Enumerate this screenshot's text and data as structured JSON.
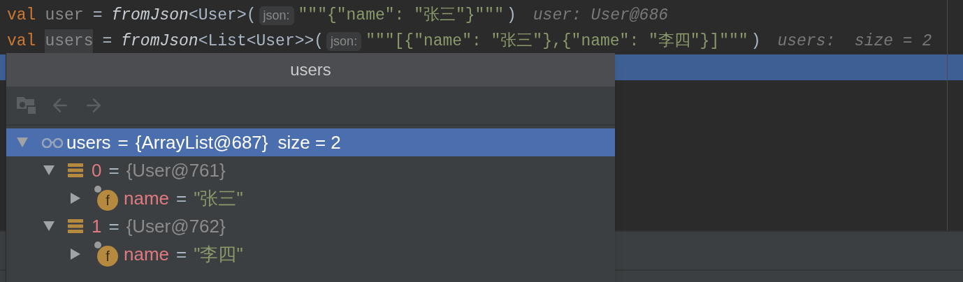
{
  "code_lines": [
    {
      "current": false,
      "tokens": [
        {
          "kind": "keyword",
          "text": "val"
        },
        {
          "kind": "variable",
          "text": "user"
        },
        {
          "kind": "plain",
          "text": "="
        },
        {
          "kind": "call",
          "text": "fromJson"
        },
        {
          "kind": "plain_tight",
          "text": "<User>("
        },
        {
          "kind": "hint",
          "text": "json:"
        },
        {
          "kind": "string",
          "text": "\"\"\"{\"name\": \"张三\"}\"\"\""
        },
        {
          "kind": "plain_tight",
          "text": ")"
        },
        {
          "kind": "debug",
          "text": "user: User@686"
        }
      ]
    },
    {
      "current": false,
      "tokens": [
        {
          "kind": "keyword",
          "text": "val"
        },
        {
          "kind": "variable_marked",
          "text": "users"
        },
        {
          "kind": "plain",
          "text": "="
        },
        {
          "kind": "call",
          "text": "fromJson"
        },
        {
          "kind": "plain_tight",
          "text": "<List<User>>("
        },
        {
          "kind": "hint",
          "text": "json:"
        },
        {
          "kind": "string",
          "text": "\"\"\"[{\"name\": \"张三\"},{\"name\": \"李四\"}]\"\"\""
        },
        {
          "kind": "plain_tight",
          "text": ")"
        },
        {
          "kind": "debug",
          "text": "users:  size = 2"
        }
      ]
    },
    {
      "current": true
    }
  ],
  "popup": {
    "title": "users",
    "toolbar": [
      {
        "kind": "folder",
        "disabled": true
      },
      {
        "kind": "back",
        "disabled": true
      },
      {
        "kind": "forward",
        "disabled": true
      }
    ],
    "tree": [
      {
        "kind": "watch",
        "name": "users",
        "sep": "=",
        "value": "{ArrayList@687}",
        "extra": "size = 2",
        "selected": true,
        "expanded": true,
        "children": [
          {
            "kind": "element",
            "name": "0",
            "sep": "=",
            "value": "{User@761}",
            "selected": false,
            "expanded": true,
            "children": [
              {
                "kind": "field",
                "badge": "f",
                "name": "name",
                "sep": "=",
                "value": "\"张三\"",
                "selected": false,
                "expanded": false
              }
            ]
          },
          {
            "kind": "element",
            "name": "1",
            "sep": "=",
            "value": "{User@762}",
            "selected": false,
            "expanded": true,
            "children": [
              {
                "kind": "field",
                "badge": "f",
                "name": "name",
                "sep": "=",
                "value": "\"李四\"",
                "selected": false,
                "expanded": false
              }
            ]
          }
        ]
      }
    ]
  }
}
